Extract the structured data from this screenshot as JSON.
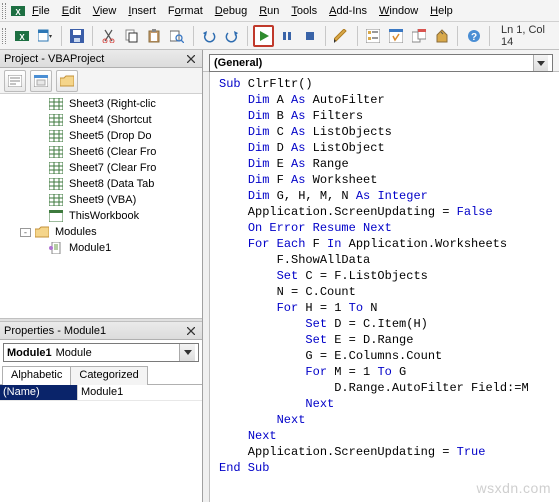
{
  "menu": {
    "file": "File",
    "edit": "Edit",
    "view": "View",
    "insert": "Insert",
    "format": "Format",
    "debug": "Debug",
    "run": "Run",
    "tools": "Tools",
    "addins": "Add-Ins",
    "window": "Window",
    "help": "Help"
  },
  "status": {
    "cursor": "Ln 1, Col 14"
  },
  "project_panel": {
    "title": "Project - VBAProject",
    "tree": {
      "sheet3": "Sheet3 (Right-clic",
      "sheet4": "Sheet4 (Shortcut",
      "sheet5": "Sheet5 (Drop Do",
      "sheet6": "Sheet6 (Clear Fro",
      "sheet7": "Sheet7 (Clear Fro",
      "sheet8": "Sheet8 (Data Tab",
      "sheet9": "Sheet9 (VBA)",
      "thiswb": "ThisWorkbook",
      "modules": "Modules",
      "module1": "Module1"
    }
  },
  "props_panel": {
    "title": "Properties - Module1",
    "object_bold": "Module1",
    "object_type": "Module",
    "tabs": {
      "alpha": "Alphabetic",
      "cat": "Categorized"
    },
    "rows": {
      "name_label": "(Name)",
      "name_val": "Module1"
    }
  },
  "code_combo": {
    "general": "(General)"
  },
  "code": {
    "l1a": "Sub",
    "l1b": " ClrFltr()",
    "l2a": "Dim",
    "l2b": " A ",
    "l2c": "As",
    "l2d": " AutoFilter",
    "l3a": "Dim",
    "l3b": " B ",
    "l3c": "As",
    "l3d": " Filters",
    "l4a": "Dim",
    "l4b": " C ",
    "l4c": "As",
    "l4d": " ListObjects",
    "l5a": "Dim",
    "l5b": " D ",
    "l5c": "As",
    "l5d": " ListObject",
    "l6a": "Dim",
    "l6b": " E ",
    "l6c": "As",
    "l6d": " Range",
    "l7a": "Dim",
    "l7b": " F ",
    "l7c": "As",
    "l7d": " Worksheet",
    "l8a": "Dim",
    "l8b": " G, H, M, N ",
    "l8c": "As Integer",
    "l9": "    Application.ScreenUpdating = ",
    "l9b": "False",
    "l10": "On Error Resume Next",
    "l11a": "For Each",
    "l11b": " F ",
    "l11c": "In",
    "l11d": " Application.Worksheets",
    "l12": "        F.ShowAllData",
    "l13a": "Set",
    "l13b": " C = F.ListObjects",
    "l14": "        N = C.Count",
    "l15a": "For",
    "l15b": " H = 1 ",
    "l15c": "To",
    "l15d": " N",
    "l16a": "Set",
    "l16b": " D = C.Item(H)",
    "l17a": "Set",
    "l17b": " E = D.Range",
    "l18": "            G = E.Columns.Count",
    "l19a": "For",
    "l19b": " M = 1 ",
    "l19c": "To",
    "l19d": " G",
    "l20": "                D.Range.AutoFilter Field:=M",
    "l21": "Next",
    "l22": "Next",
    "l23": "Next",
    "l24": "    Application.ScreenUpdating = ",
    "l24b": "True",
    "l25": "End Sub"
  },
  "watermark": "wsxdn.com"
}
